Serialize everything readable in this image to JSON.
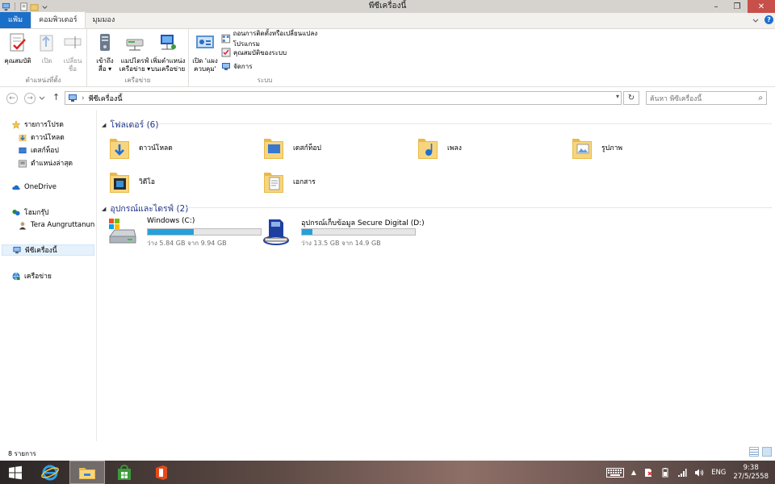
{
  "window": {
    "title": "พีซีเครื่องนี้",
    "minimize": "–",
    "maximize": "❐",
    "close": "✕"
  },
  "ribbon_tabs": [
    "แฟ้ม",
    "คอมพิวเตอร์",
    "มุมมอง"
  ],
  "ribbon": {
    "location_group": {
      "label": "ตำแหน่งที่ตั้ง",
      "properties": "คุณสมบัติ",
      "open": "เปิด",
      "rename_1": "เปลี่ยน",
      "rename_2": "ชื่อ"
    },
    "network_group": {
      "label": "เครือข่าย",
      "access_media_1": "เข้าถึง",
      "access_media_2": "สื่อ",
      "map_drive_1": "แมปไดรฟ์",
      "map_drive_2": "เครือข่าย",
      "add_location_1": "เพิ่มตำแหน่ง",
      "add_location_2": "บนเครือข่าย"
    },
    "system_group": {
      "label": "ระบบ",
      "open_settings_1": "เปิด 'แผง",
      "open_settings_2": "ควบคุม'",
      "uninstall": "ถอนการติดตั้งหรือเปลี่ยนแปลงโปรแกรม",
      "system_properties": "คุณสมบัติของระบบ",
      "manage": "จัดการ"
    }
  },
  "address": {
    "location": "พีซีเครื่องนี้",
    "search_placeholder": "ค้นหา พีซีเครื่องนี้"
  },
  "navpane": {
    "favorites": "รายการโปรด",
    "downloads": "ดาวน์โหลด",
    "desktop": "เดสก์ท็อป",
    "recent": "ตำแหน่งล่าสุด",
    "onedrive": "OneDrive",
    "homegroup": "โฮมกรุ๊ป",
    "user": "Tera Aungruttanun",
    "thispc": "พีซีเครื่องนี้",
    "network": "เครือข่าย"
  },
  "folders_section": {
    "heading": "โฟลเดอร์ (6)",
    "items": [
      "ดาวน์โหลด",
      "เดสก์ท็อป",
      "เพลง",
      "รูปภาพ",
      "วิดีโอ",
      "เอกสาร"
    ]
  },
  "drives_section": {
    "heading": "อุปกรณ์และไดรฟ์ (2)",
    "drives": [
      {
        "name": "Windows (C:)",
        "free": "ว่าง 5.84 GB จาก 9.94 GB",
        "used_fraction": 0.41
      },
      {
        "name": "อุปกรณ์เก็บข้อมูล Secure Digital (D:)",
        "free": "ว่าง 13.5 GB จาก 14.9 GB",
        "used_fraction": 0.09
      }
    ]
  },
  "status": {
    "count": "8 รายการ"
  },
  "taskbar": {
    "language": "ENG",
    "time": "9:38",
    "date": "27/5/2558"
  },
  "colors": {
    "accent": "#1a6fc9",
    "drive_fill": "#26a0da",
    "section_heading": "#1e3287",
    "folder": "#f2c96a"
  }
}
